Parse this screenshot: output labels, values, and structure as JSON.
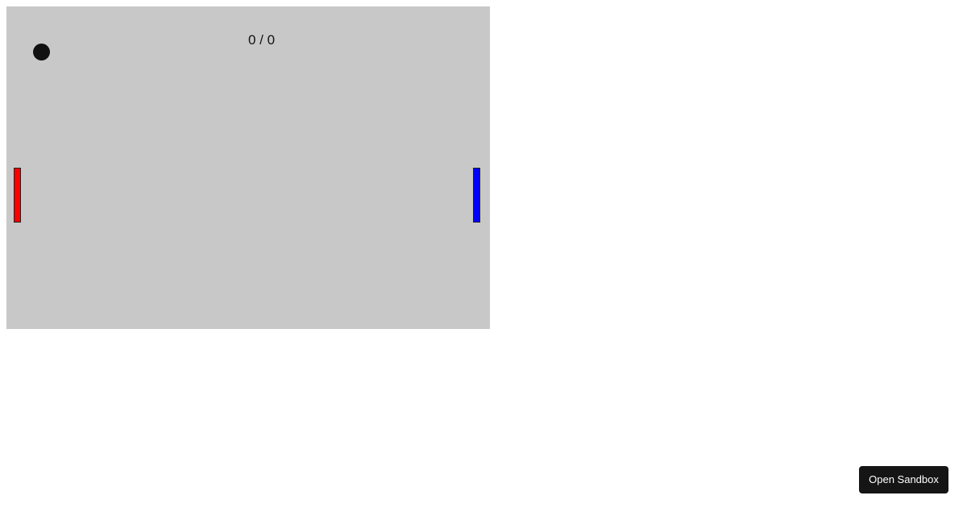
{
  "game": {
    "score": "0 / 0",
    "colors": {
      "field": "#c8c8c8",
      "ball": "#111111",
      "left_paddle": "#ff0000",
      "right_paddle": "#0000ff"
    }
  },
  "footer": {
    "sandbox_label": "Open Sandbox"
  }
}
